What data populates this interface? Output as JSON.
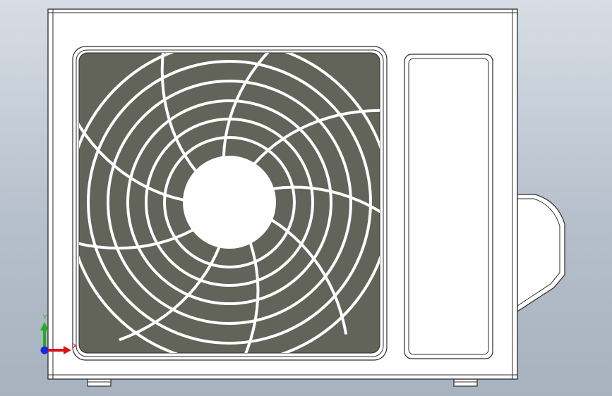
{
  "viewport": {
    "background_top": "#d7dde4",
    "background_bottom": "#a7b2bf"
  },
  "model": {
    "body_color": "#ffffff",
    "outline_color": "#2b2b2b",
    "grille_fill": "#62645a",
    "grille_bars": "#ffffff",
    "grille_rings": 6,
    "grille_spokes": 9
  },
  "triad": {
    "y_label": "Y",
    "x_label": "X",
    "y_color": "#22aa22",
    "x_color": "#dd1111",
    "origin_color": "#1a2ad8"
  }
}
